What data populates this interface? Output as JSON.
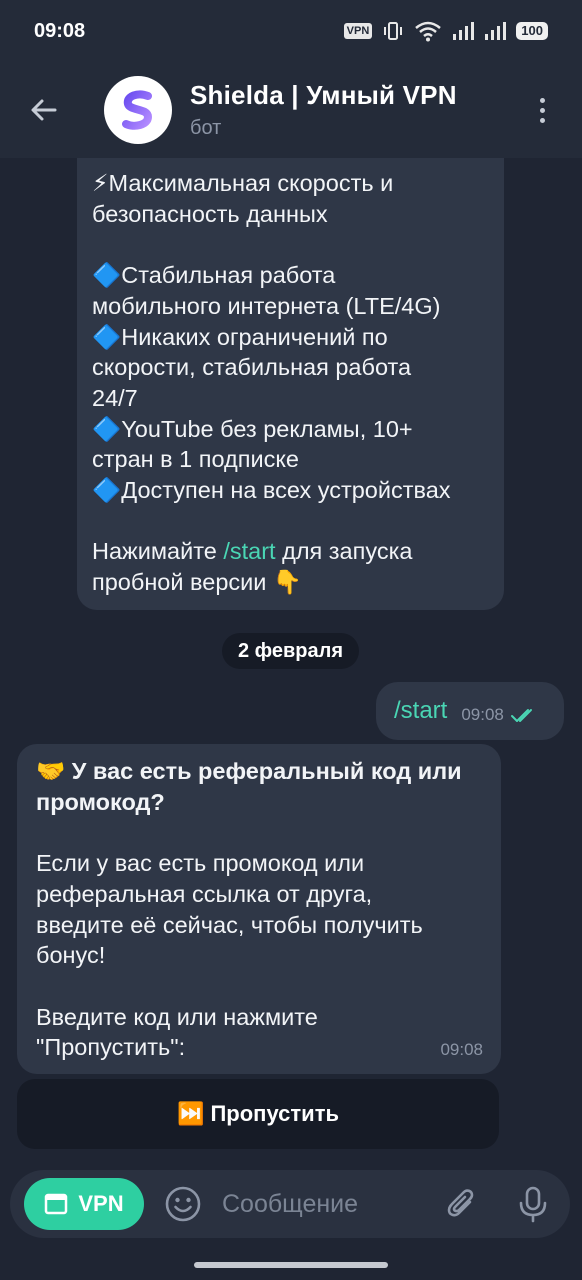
{
  "status_bar": {
    "time": "09:08",
    "vpn_label": "VPN",
    "battery": "100"
  },
  "header": {
    "title": "Shielda | Умный VPN",
    "subtitle": "бот"
  },
  "messages": {
    "bot_intro": {
      "line1": "⚡Максимальная скорость и\nбезопасность данных",
      "line2": "🔷Стабильная работа\nмобильного интернета (LTE/4G)\n🔷Никаких ограничений по\nскорости, стабильная работа\n24/7\n🔷YouTube без рекламы, 10+\nстран в 1 подписке\n🔷Доступен на всех устройствах",
      "cta_prefix": "Нажимайте ",
      "cta_link": "/start",
      "cta_suffix": " для запуска\nпробной версии 👇"
    },
    "date_divider": "2 февраля",
    "user_message": {
      "text": "/start",
      "time": "09:08"
    },
    "bot_referral": {
      "title": "🤝 У вас есть реферальный код или\nпромокод?",
      "body": "Если у вас есть промокод или\nреферальная ссылка от друга,\nвведите её сейчас, чтобы получить\nбонус!",
      "prompt": "Введите код или нажмите\n\"Пропустить\":",
      "time": "09:08"
    },
    "keyboard_button": "⏭️ Пропустить"
  },
  "input_bar": {
    "vpn_button": "VPN",
    "placeholder": "Сообщение"
  },
  "colors": {
    "background": "#1f2533",
    "bubble": "#2f3747",
    "accent": "#4ad6b4",
    "vpn_button": "#2ecfa1"
  }
}
